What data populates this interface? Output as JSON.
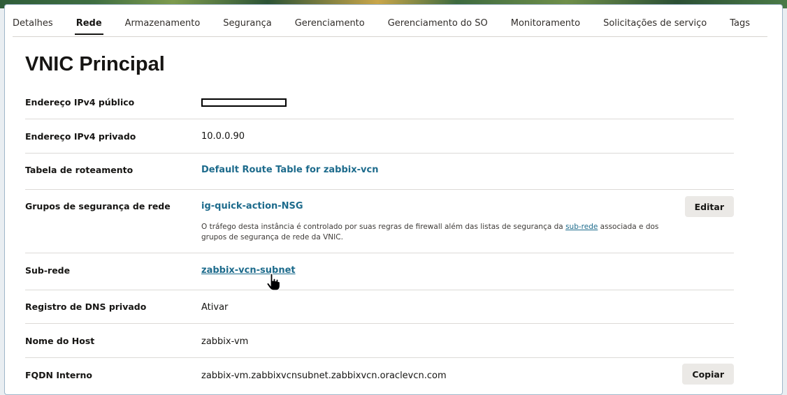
{
  "tabs": [
    {
      "label": "Detalhes",
      "active": false
    },
    {
      "label": "Rede",
      "active": true
    },
    {
      "label": "Armazenamento",
      "active": false
    },
    {
      "label": "Segurança",
      "active": false
    },
    {
      "label": "Gerenciamento",
      "active": false
    },
    {
      "label": "Gerenciamento do SO",
      "active": false
    },
    {
      "label": "Monitoramento",
      "active": false
    },
    {
      "label": "Solicitações de serviço",
      "active": false
    },
    {
      "label": "Tags",
      "active": false
    }
  ],
  "section": {
    "title": "VNIC Principal"
  },
  "fields": {
    "public_ipv4": {
      "label": "Endereço IPv4 público"
    },
    "private_ipv4": {
      "label": "Endereço IPv4 privado",
      "value": "10.0.0.90"
    },
    "route_table": {
      "label": "Tabela de roteamento",
      "value": "Default Route Table for zabbix-vcn"
    },
    "nsg": {
      "label": "Grupos de segurança de rede",
      "value": "ig-quick-action-NSG",
      "button": "Editar",
      "note_before": "O tráfego desta instância é controlado por suas regras de firewall além das listas de segurança da ",
      "note_link": "sub-rede",
      "note_after": " associada e dos grupos de segurança de rede da VNIC."
    },
    "subnet": {
      "label": "Sub-rede",
      "value": "zabbix-vcn-subnet"
    },
    "private_dns": {
      "label": "Registro de DNS privado",
      "value": "Ativar"
    },
    "hostname": {
      "label": "Nome do Host",
      "value": "zabbix-vm"
    },
    "fqdn": {
      "label": "FQDN Interno",
      "value": "zabbix-vm.zabbixvcnsubnet.zabbixvcn.oraclevcn.com",
      "button": "Copiar"
    }
  },
  "icons": {
    "cursor": "hand-pointer-icon"
  },
  "colors": {
    "link": "#1d6b8c",
    "button_bg": "#ebe9e6",
    "frame_border": "#9fb6c9"
  }
}
